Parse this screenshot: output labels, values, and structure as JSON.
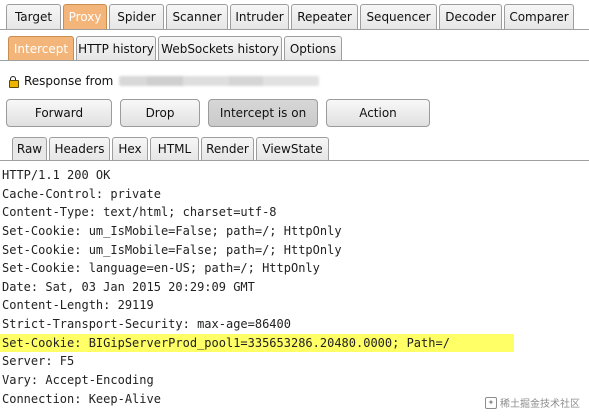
{
  "top_tabs": [
    "Target",
    "Proxy",
    "Spider",
    "Scanner",
    "Intruder",
    "Repeater",
    "Sequencer",
    "Decoder",
    "Comparer"
  ],
  "sub_tabs": [
    "Intercept",
    "HTTP history",
    "WebSockets history",
    "Options"
  ],
  "response": {
    "label": "Response from"
  },
  "buttons": {
    "forward": "Forward",
    "drop": "Drop",
    "intercept": "Intercept is on",
    "action": "Action"
  },
  "view_tabs": [
    "Raw",
    "Headers",
    "Hex",
    "HTML",
    "Render",
    "ViewState"
  ],
  "response_lines": [
    "HTTP/1.1 200 OK",
    "Cache-Control: private",
    "Content-Type: text/html; charset=utf-8",
    "Set-Cookie: um_IsMobile=False; path=/; HttpOnly",
    "Set-Cookie: um_IsMobile=False; path=/; HttpOnly",
    "Set-Cookie: language=en-US; path=/; HttpOnly",
    "Date: Sat, 03 Jan 2015 20:29:09 GMT",
    "Content-Length: 29119",
    "Strict-Transport-Security: max-age=86400",
    "Set-Cookie: BIGipServerProd_pool1=335653286.20480.0000; Path=/",
    "Server: F5",
    "Vary: Accept-Encoding",
    "Connection: Keep-Alive"
  ],
  "watermark": "稀土掘金技术社区",
  "colors": {
    "highlight": "#ffff66",
    "proxy_tab": "#f3b57a",
    "lock": "#f0b400"
  }
}
